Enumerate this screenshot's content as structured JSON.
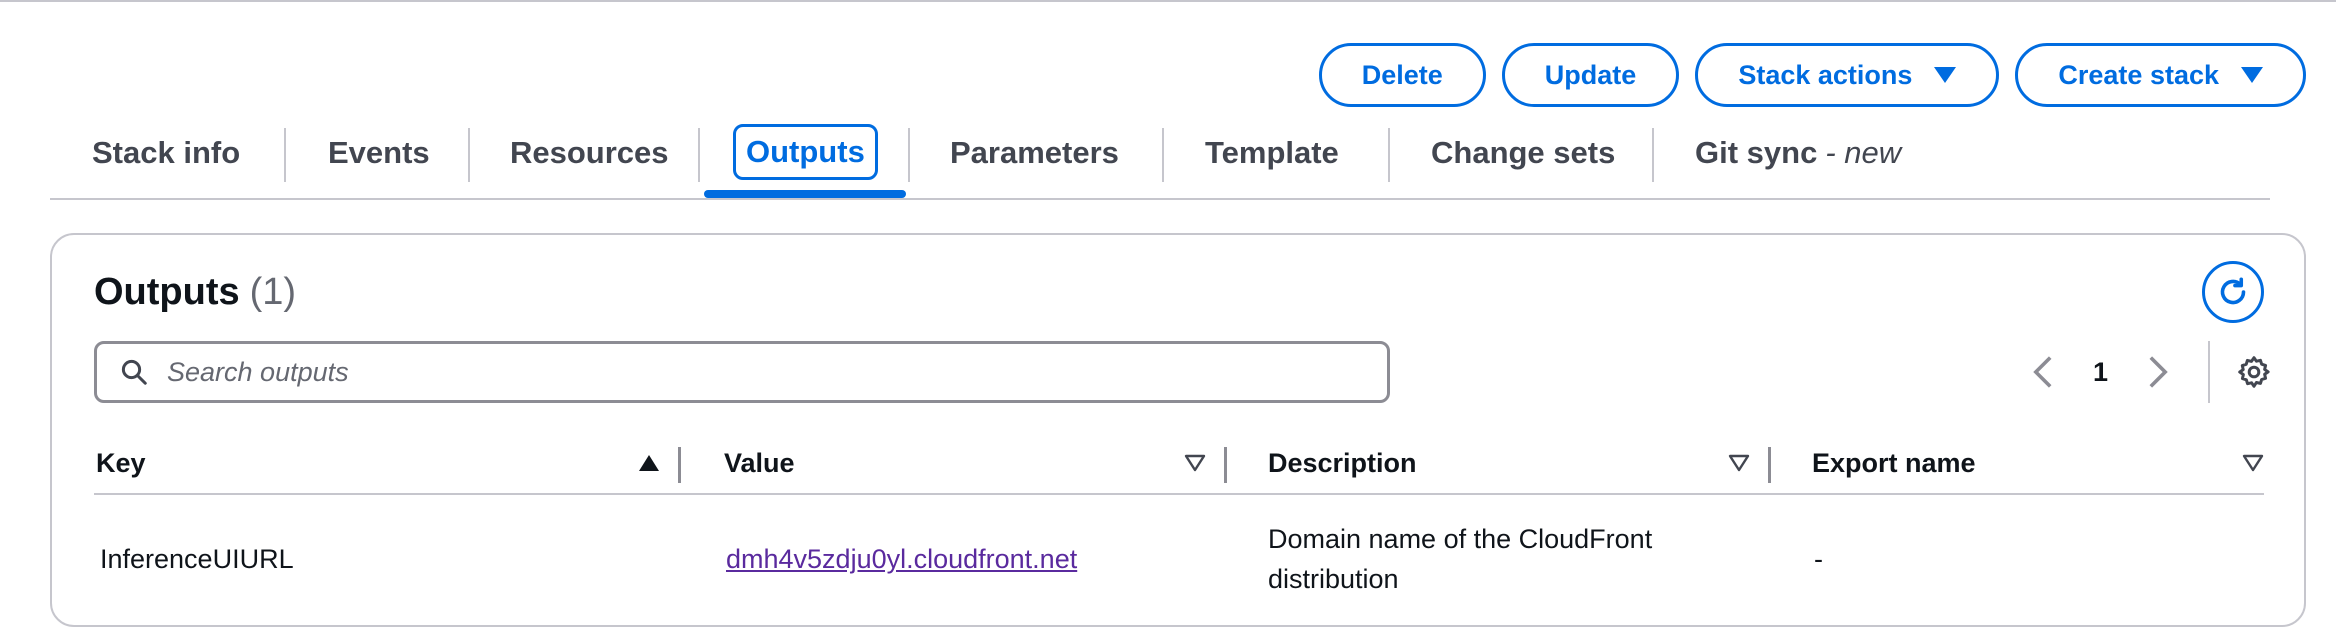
{
  "actions": {
    "delete_label": "Delete",
    "update_label": "Update",
    "stack_actions_label": "Stack actions",
    "create_stack_label": "Create stack"
  },
  "tabs": [
    {
      "label": "Stack info"
    },
    {
      "label": "Events"
    },
    {
      "label": "Resources"
    },
    {
      "label": "Outputs",
      "active": true
    },
    {
      "label": "Parameters"
    },
    {
      "label": "Template"
    },
    {
      "label": "Change sets"
    },
    {
      "label": "Git sync",
      "suffix": "- new"
    }
  ],
  "panel": {
    "title": "Outputs",
    "count": "(1)"
  },
  "search": {
    "placeholder": "Search outputs"
  },
  "pagination": {
    "current_page": "1"
  },
  "table": {
    "columns": [
      "Key",
      "Value",
      "Description",
      "Export name"
    ],
    "rows": [
      {
        "key": "InferenceUIURL",
        "value": "dmh4v5zdju0yl.cloudfront.net",
        "description": "Domain name of the CloudFront distribution",
        "export_name": "-"
      }
    ]
  },
  "colors": {
    "accent": "#006ce0",
    "link_visited": "#5a2a9e",
    "border": "#c6c6cd"
  }
}
